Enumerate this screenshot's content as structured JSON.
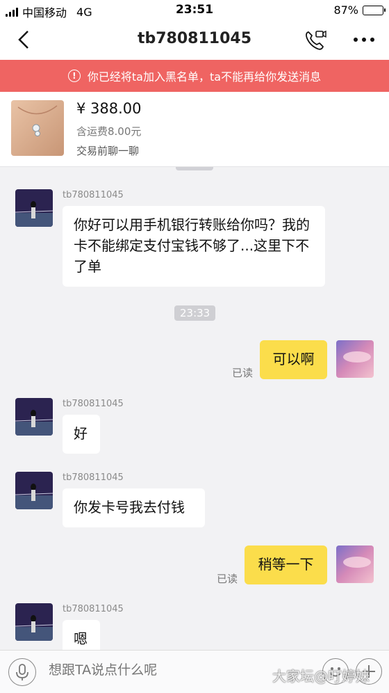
{
  "status_bar": {
    "carrier": "中国移动",
    "network": "4G",
    "time": "23:51",
    "battery": "87%",
    "battery_level": 0.87
  },
  "header": {
    "title": "tb780811045"
  },
  "banner": {
    "text": "你已经将ta加入黑名单，ta不能再给你发送消息"
  },
  "product": {
    "price": "¥ 388.00",
    "shipping": "含运费8.00元",
    "chat_label": "交易前聊一聊"
  },
  "messages": [
    {
      "sender": "tb780811045",
      "text": "你好可以用手机银行转账给你吗？我的卡不能绑定支付宝钱不够了...这里下不了单"
    },
    {
      "time": "23:33"
    },
    {
      "read": "已读",
      "text": "可以啊"
    },
    {
      "sender": "tb780811045",
      "text": "好"
    },
    {
      "sender": "tb780811045",
      "text": "你发卡号我去付钱"
    },
    {
      "read": "已读",
      "text": "稍等一下"
    },
    {
      "sender": "tb780811045",
      "text": "嗯"
    }
  ],
  "input": {
    "placeholder": "想跟TA说点什么呢"
  },
  "watermark": "大家坛@叮婷妹"
}
